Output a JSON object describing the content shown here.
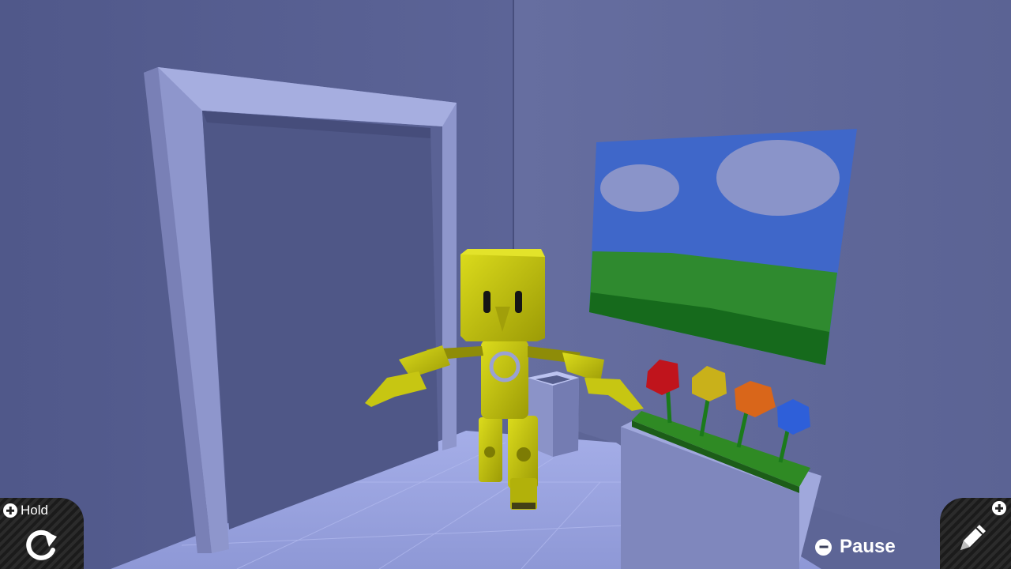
{
  "hud": {
    "hold_label": "Hold",
    "pause_label": "Pause",
    "hold_button_icon": "plus-icon",
    "rotate_icon": "rotate-icon",
    "edit_button_icon": "plus-icon",
    "pencil_icon": "pencil-icon",
    "pause_button_icon": "minus-icon"
  },
  "scene": {
    "character": "yellow-robot",
    "objects": [
      "doorway",
      "painting",
      "flower-planter",
      "small-pedestal"
    ],
    "flower_colors": [
      "#c0141c",
      "#c9b11a",
      "#d9661a",
      "#2e5fd9"
    ],
    "robot_color": "#c3c20e",
    "wall_color": "#5d6596"
  }
}
